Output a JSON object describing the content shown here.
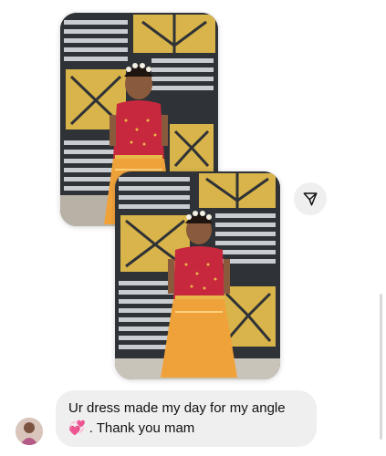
{
  "message": {
    "line1": "Ur dress made my day for my angle",
    "emoji": "💞",
    "line2": ". Thank you mam"
  },
  "icons": {
    "share": "paper-plane-icon",
    "avatar": "user-avatar"
  },
  "colors": {
    "bubble": "#efefef",
    "dress_top": "#c8283d",
    "skirt": "#f0a23a",
    "gate_gold": "#d8b44a",
    "gate_frame": "#2d2d2d"
  }
}
